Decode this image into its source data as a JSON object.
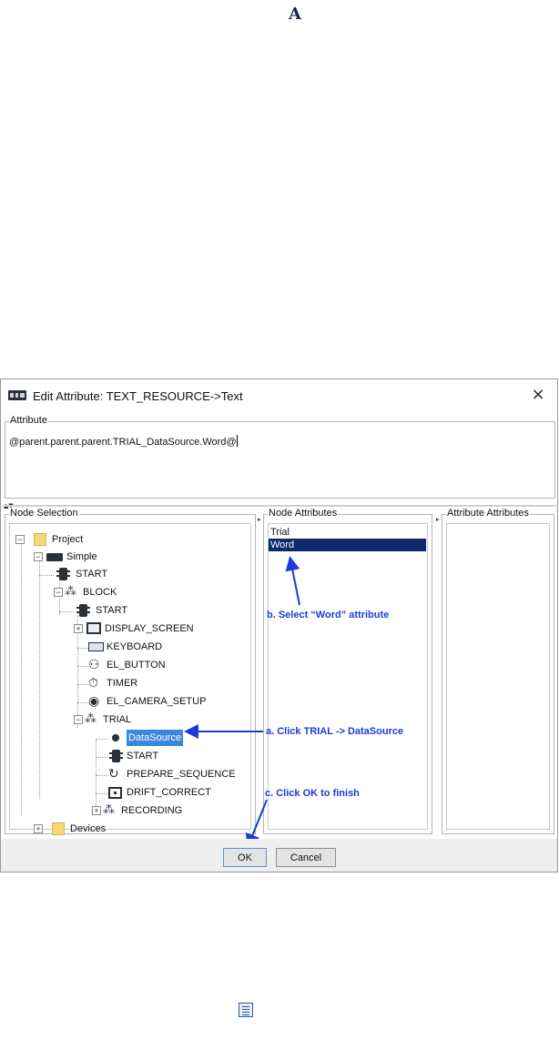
{
  "page": {
    "glyph_top": "A"
  },
  "dialog": {
    "title": "Edit Attribute: TEXT_RESOURCE->Text",
    "close_symbol": "×",
    "attribute_legend": "Attribute",
    "attribute_value": "@parent.parent.parent.TRIAL_DataSource.Word@",
    "node_selection_legend": "Node Selection",
    "node_attributes_legend": "Node Attributes",
    "attribute_attributes_legend": "Attribute Attributes",
    "tree": [
      {
        "label": "Project",
        "icon": "folder-icon",
        "expander": "−"
      },
      {
        "label": "Simple",
        "icon": "experiment-icon",
        "expander": "−"
      },
      {
        "label": "START",
        "icon": "traffic-light-icon"
      },
      {
        "label": "BLOCK",
        "icon": "sequence-icon",
        "expander": "−"
      },
      {
        "label": "START",
        "icon": "traffic-light-icon"
      },
      {
        "label": "DISPLAY_SCREEN",
        "icon": "monitor-icon",
        "expander": "+"
      },
      {
        "label": "KEYBOARD",
        "icon": "keyboard-icon"
      },
      {
        "label": "EL_BUTTON",
        "icon": "gamepad-icon"
      },
      {
        "label": "TIMER",
        "icon": "timer-icon"
      },
      {
        "label": "EL_CAMERA_SETUP",
        "icon": "eye-icon"
      },
      {
        "label": "TRIAL",
        "icon": "sequence-icon",
        "expander": "−"
      },
      {
        "label": "DataSource",
        "icon": "datasource-dot-icon",
        "selected": true
      },
      {
        "label": "START",
        "icon": "traffic-light-icon"
      },
      {
        "label": "PREPARE_SEQUENCE",
        "icon": "refresh-icon"
      },
      {
        "label": "DRIFT_CORRECT",
        "icon": "drift-correct-icon"
      },
      {
        "label": "RECORDING",
        "icon": "sequence-icon",
        "expander": "+"
      },
      {
        "label": "Devices",
        "icon": "folder-icon",
        "expander": "+"
      }
    ],
    "node_attributes": [
      {
        "label": "Trial",
        "selected": false
      },
      {
        "label": "Word",
        "selected": true
      }
    ],
    "annotations": {
      "select_word": "b. Select “Word” attribute",
      "click_trial": "a. Click TRIAL -> DataSource",
      "click_ok": "c. Click OK to finish"
    },
    "buttons": {
      "ok": "OK",
      "cancel": "Cancel"
    },
    "colors": {
      "annotation": "#1b3bd9",
      "selection": "#3c87dc",
      "list_selection": "#0e2a6c"
    }
  }
}
